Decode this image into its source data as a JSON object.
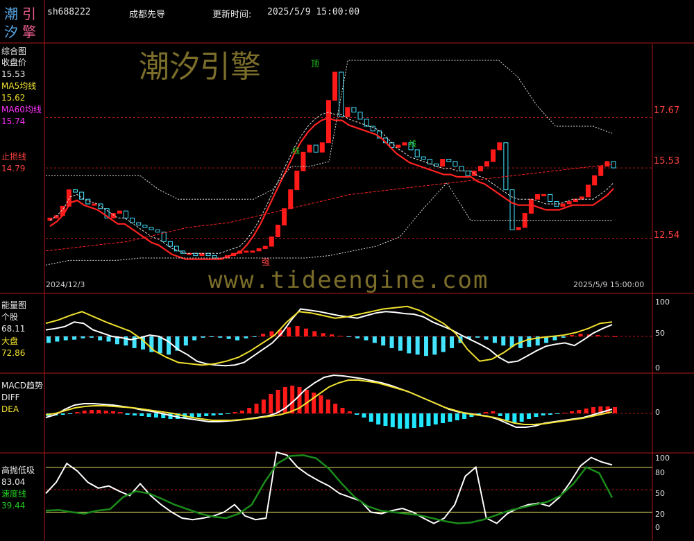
{
  "header": {
    "code": "sh688222",
    "name": "成都先导",
    "update_label": "更新时间:",
    "update_time": "2025/5/9 15:00:00"
  },
  "logo": {
    "chars": [
      "潮",
      "引",
      "汐",
      "擎"
    ]
  },
  "watermarks": {
    "cn": "潮汐引擎",
    "url": "www.tideengine.com"
  },
  "panels": {
    "main": {
      "title": "综合图",
      "close_label": "收盘价",
      "close_value": "15.53",
      "ma5_label": "MA5均线",
      "ma5_value": "15.62",
      "ma60_label": "MA60均线",
      "ma60_value": "15.74",
      "stop_label": "止损线",
      "stop_value": "14.79",
      "price_ticks": [
        "17.67",
        "15.53",
        "12.54"
      ],
      "marker_top": "顶",
      "marker_strong": "强",
      "marker_mid1": "线",
      "marker_mid2": "线",
      "date_start": "2024/12/3",
      "date_end": "2025/5/9 15:00:00"
    },
    "energy": {
      "title": "能量图",
      "stock_label": "个股",
      "stock_value": "68.11",
      "market_label": "大盘",
      "market_value": "72.86",
      "ticks": [
        "100",
        "50",
        "0"
      ]
    },
    "macd": {
      "title": "MACD趋势",
      "diff_label": "DIFF",
      "dea_label": "DEA",
      "ticks": [
        "0"
      ]
    },
    "osc": {
      "title": "高抛低吸",
      "value": "83.04",
      "speed_label": "速度线",
      "speed_value": "39.44",
      "ticks": [
        "100",
        "80",
        "50",
        "20",
        "0"
      ]
    }
  },
  "colors": {
    "up": "#ff1a1a",
    "down": "#44e4ff",
    "ma5": "#e0e0e0",
    "ma60": "#ff2222",
    "band": "#e0e0e0",
    "macd_pos": "#ff1a1a",
    "macd_neg": "#22e8ff",
    "diff": "#ffffff",
    "dea": "#f0e130",
    "speed": "#1a8c1a",
    "grid": "#b01818"
  },
  "chart_data": [
    {
      "type": "candlestick",
      "title": "综合图",
      "x_start": "2024/12/3",
      "x_end": "2025/5/9",
      "ylim": [
        11.3,
        20.4
      ],
      "ticks": [
        17.67,
        15.53,
        12.54
      ],
      "close": [
        13.4,
        13.5,
        13.9,
        14.6,
        14.5,
        14.2,
        14.0,
        14.0,
        13.8,
        13.4,
        13.6,
        13.7,
        13.4,
        13.2,
        13.1,
        13.0,
        12.9,
        12.8,
        12.4,
        12.2,
        12.0,
        11.9,
        11.9,
        11.8,
        11.9,
        11.8,
        11.7,
        11.7,
        11.8,
        11.9,
        12.0,
        12.0,
        12.0,
        12.1,
        12.2,
        12.6,
        13.1,
        13.8,
        14.6,
        15.4,
        16.2,
        16.5,
        16.2,
        16.6,
        18.4,
        19.6,
        17.7,
        18.1,
        17.9,
        17.6,
        17.3,
        17.1,
        16.8,
        16.6,
        16.4,
        16.5,
        16.6,
        16.3,
        16.0,
        15.9,
        15.7,
        15.6,
        15.9,
        15.8,
        15.6,
        15.4,
        15.2,
        15.4,
        15.6,
        15.8,
        16.3,
        16.6,
        14.6,
        12.9,
        13.0,
        13.6,
        14.2,
        14.4,
        14.4,
        14.1,
        13.9,
        14.0,
        14.1,
        14.2,
        14.3,
        14.8,
        15.2,
        15.6,
        15.8,
        15.53
      ],
      "ma5": [
        13.3,
        13.5,
        13.8,
        14.3,
        14.4,
        14.2,
        14.1,
        14.0,
        13.8,
        13.6,
        13.4,
        13.4,
        13.2,
        13.0,
        12.8,
        12.6,
        12.5,
        12.3,
        12.1,
        12.0,
        11.9,
        11.9,
        11.9,
        11.9,
        11.9,
        11.9,
        12.0,
        12.1,
        12.2,
        12.5,
        12.9,
        13.4,
        14.0,
        14.6,
        15.2,
        15.8,
        16.4,
        16.9,
        17.3,
        17.6,
        17.8,
        17.9,
        17.8,
        17.8,
        17.6,
        17.5,
        17.4,
        17.3,
        17.2,
        17.0,
        16.7,
        16.4,
        16.2,
        16.0,
        15.9,
        15.8,
        15.7,
        15.6,
        15.5,
        15.5,
        15.4,
        15.4,
        15.4,
        15.2,
        15.1,
        14.9,
        14.7,
        14.5,
        14.3,
        14.2,
        14.2,
        14.2,
        14.1,
        14.0,
        14.0,
        14.0,
        14.1,
        14.2,
        14.2,
        14.2,
        14.2,
        14.4,
        14.6,
        14.9
      ],
      "ma60": [
        12.0,
        12.1,
        12.2,
        12.3,
        12.4,
        12.6,
        12.8,
        13.0,
        13.1,
        13.2,
        13.4,
        13.6,
        13.8,
        14.0,
        14.2,
        14.4,
        14.5,
        14.6,
        14.7,
        14.8,
        14.9,
        15.0,
        15.1,
        15.2,
        15.3,
        15.4,
        15.5,
        15.6,
        15.7
      ],
      "band_upper": [
        15.2,
        15.2,
        15.2,
        15.2,
        15.2,
        15.2,
        14.6,
        14.2,
        14.2,
        14.2,
        14.2,
        14.2,
        14.6,
        15.6,
        15.6,
        15.8,
        20.1,
        20.1,
        20.1,
        20.1,
        20.1,
        20.1,
        20.1,
        20.1,
        20.1,
        19.4,
        18.2,
        17.3,
        17.3,
        17.3,
        17.0
      ],
      "band_lower": [
        11.4,
        11.6,
        11.6,
        11.6,
        11.7,
        11.7,
        11.7,
        11.7,
        11.7,
        11.7,
        11.7,
        11.7,
        11.8,
        12.0,
        12.2,
        12.6,
        13.8,
        14.9,
        13.3,
        13.3,
        13.3,
        13.3,
        13.3,
        13.3,
        13.3
      ]
    },
    {
      "type": "bar+line",
      "title": "能量图",
      "ylim": [
        0,
        100
      ],
      "stock": [
        60,
        62,
        65,
        72,
        70,
        60,
        55,
        50,
        48,
        45,
        48,
        52,
        50,
        42,
        30,
        22,
        12,
        8,
        6,
        5,
        6,
        10,
        20,
        30,
        40,
        55,
        75,
        92,
        90,
        88,
        85,
        82,
        80,
        78,
        82,
        86,
        88,
        87,
        85,
        84,
        80,
        72,
        66,
        60,
        52,
        45,
        38,
        30,
        18,
        10,
        12,
        20,
        28,
        35,
        38,
        40,
        36,
        45,
        55,
        62,
        68
      ],
      "market": [
        70,
        75,
        82,
        88,
        80,
        72,
        65,
        58,
        45,
        28,
        18,
        10,
        8,
        6,
        8,
        12,
        18,
        28,
        40,
        52,
        72,
        88,
        86,
        82,
        78,
        80,
        84,
        88,
        92,
        94,
        96,
        90,
        80,
        70,
        55,
        30,
        12,
        15,
        25,
        38,
        45,
        48,
        50,
        52,
        56,
        62,
        70,
        72
      ],
      "bars": [
        -10,
        -8,
        -6,
        -5,
        -3,
        -2,
        -6,
        -8,
        -12,
        -14,
        -18,
        -20,
        -24,
        -26,
        -28,
        -22,
        -14,
        -6,
        -2,
        -1,
        -2,
        -4,
        -6,
        -3,
        -1,
        4,
        8,
        10,
        14,
        16,
        12,
        8,
        5,
        3,
        1,
        -1,
        -3,
        -6,
        -10,
        -14,
        -18,
        -22,
        -26,
        -28,
        -30,
        -28,
        -24,
        -18,
        -10,
        -4,
        -2,
        -5,
        -10,
        -14,
        -16,
        -18,
        -16,
        -14,
        -10,
        -6,
        -2,
        2,
        4,
        3,
        2,
        1,
        0
      ]
    },
    {
      "type": "bar+line",
      "title": "MACD趋势",
      "bars": [
        -4,
        -3,
        -2,
        -1,
        2,
        4,
        5,
        5,
        4,
        3,
        2,
        -2,
        -3,
        -4,
        -5,
        -6,
        -7,
        -8,
        -8,
        -7,
        -6,
        -5,
        -4,
        -3,
        -2,
        -1,
        2,
        4,
        8,
        14,
        20,
        28,
        34,
        38,
        40,
        38,
        34,
        30,
        26,
        20,
        14,
        8,
        3,
        -2,
        -6,
        -12,
        -16,
        -18,
        -20,
        -22,
        -22,
        -21,
        -20,
        -18,
        -16,
        -14,
        -12,
        -10,
        -8,
        -5,
        -3,
        2,
        3,
        -4,
        -10,
        -14,
        -12,
        -8,
        -5,
        -3,
        -2,
        -1,
        1,
        3,
        5,
        7,
        9,
        10,
        10,
        9
      ],
      "diff": [
        -6,
        -2,
        6,
        12,
        14,
        14,
        13,
        12,
        10,
        8,
        5,
        3,
        0,
        -3,
        -6,
        -8,
        -10,
        -12,
        -12,
        -11,
        -10,
        -8,
        -6,
        -4,
        0,
        8,
        20,
        34,
        44,
        52,
        55,
        54,
        52,
        50,
        47,
        44,
        40,
        35,
        30,
        24,
        18,
        12,
        6,
        2,
        0,
        -2,
        -4,
        -8,
        -14,
        -20,
        -20,
        -18,
        -14,
        -12,
        -10,
        -8,
        -6,
        -2,
        2,
        6
      ],
      "dea": [
        -2,
        0,
        4,
        8,
        10,
        11,
        11,
        10,
        9,
        8,
        6,
        4,
        2,
        0,
        -3,
        -6,
        -8,
        -10,
        -10,
        -10,
        -9,
        -8,
        -6,
        -4,
        -2,
        2,
        8,
        18,
        28,
        38,
        44,
        48,
        48,
        46,
        44,
        40,
        36,
        32,
        26,
        20,
        14,
        8,
        4,
        0,
        -2,
        -4,
        -6,
        -10,
        -14,
        -16,
        -16,
        -15,
        -13,
        -11,
        -9,
        -7,
        -4,
        -1,
        2
      ]
    },
    {
      "type": "line",
      "title": "高抛低吸",
      "ylim": [
        0,
        100
      ],
      "ticks": [
        100,
        80,
        50,
        20,
        0
      ],
      "value": [
        45,
        60,
        85,
        75,
        60,
        52,
        55,
        48,
        42,
        58,
        42,
        30,
        20,
        12,
        10,
        12,
        15,
        20,
        30,
        15,
        10,
        12,
        100,
        96,
        80,
        70,
        62,
        55,
        45,
        40,
        35,
        20,
        18,
        22,
        25,
        20,
        12,
        5,
        12,
        30,
        68,
        80,
        12,
        5,
        18,
        25,
        30,
        32,
        28,
        40,
        60,
        82,
        93,
        87,
        83.04
      ],
      "speed": [
        22,
        23,
        20,
        18,
        22,
        24,
        40,
        48,
        45,
        38,
        30,
        24,
        18,
        14,
        12,
        18,
        30,
        60,
        85,
        95,
        96,
        92,
        78,
        58,
        40,
        28,
        22,
        20,
        18,
        16,
        12,
        8,
        5,
        6,
        10,
        16,
        22,
        26,
        30,
        34,
        42,
        58,
        80,
        72,
        39.44
      ]
    }
  ]
}
